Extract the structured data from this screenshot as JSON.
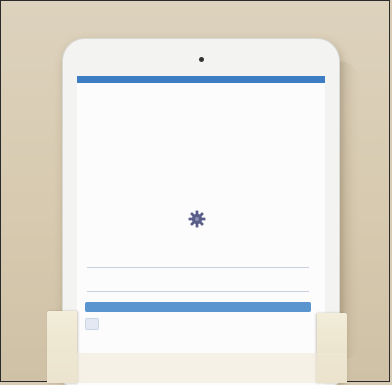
{
  "status_bar": {
    "text": ""
  },
  "login": {
    "app_name": "",
    "username_label": "",
    "password_label": "",
    "login_button": "",
    "forgot_link": "",
    "footer_line1": "",
    "footer_line2": "",
    "footer_line3": ""
  },
  "colors": {
    "status_bar": "#3d7dc4",
    "button": "#5b95cf",
    "background_wall": "#d9ccb4",
    "tablet_bezel": "#f3f3f1"
  },
  "icons": [
    "front-camera-icon",
    "gear-logo-icon",
    "app-corner-icon"
  ]
}
